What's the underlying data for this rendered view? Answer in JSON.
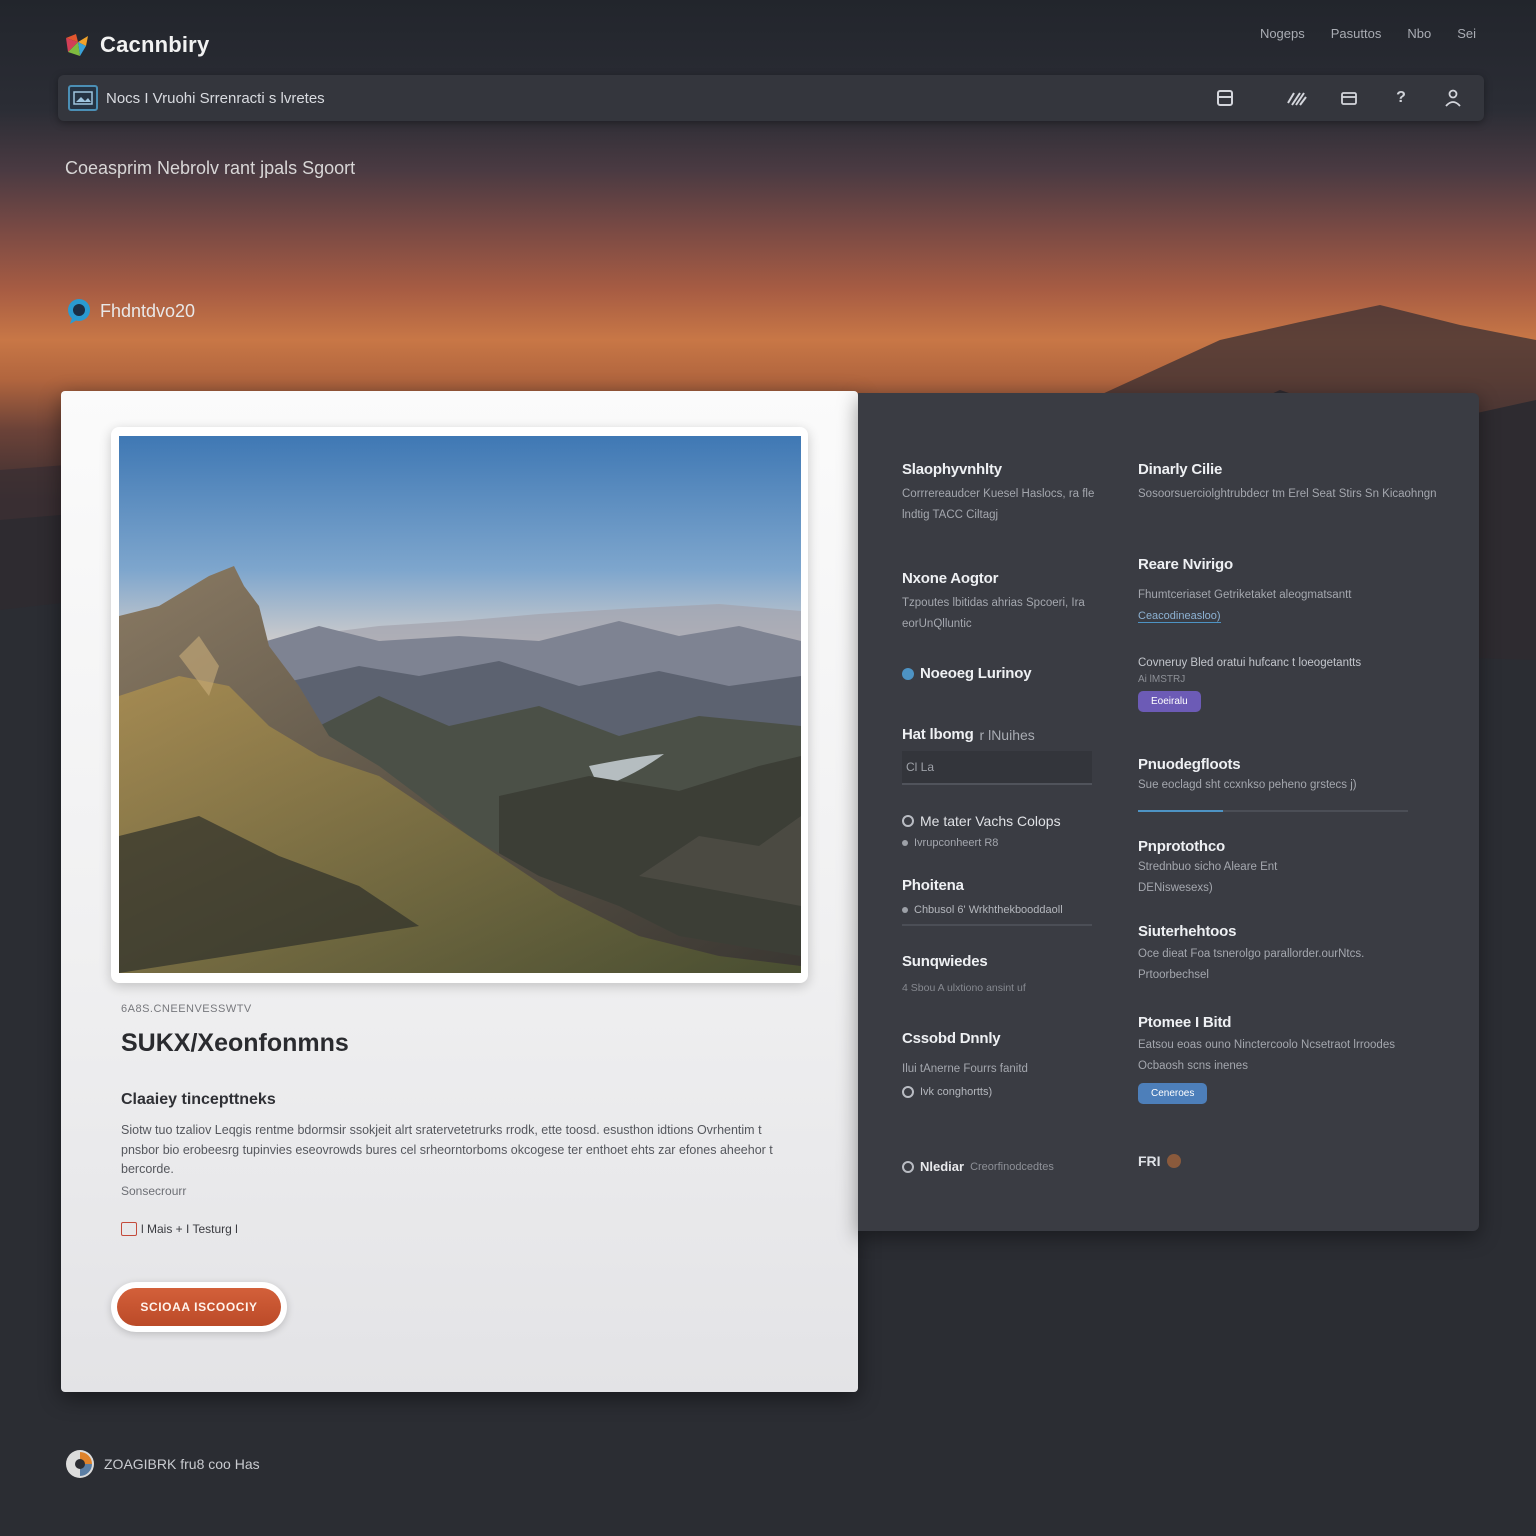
{
  "header": {
    "brand_name": "Cacnnbiry",
    "nav": [
      "Nogeps",
      "Pasuttos",
      "Nbo",
      "Sei"
    ]
  },
  "toolbar": {
    "path": "Nocs I Vruohi Srrenracti s lvretes",
    "icons": [
      "layout-icon",
      "signal-icon",
      "folder-icon",
      "help-icon",
      "user-icon"
    ]
  },
  "page": {
    "subtitle": "Coeasprim Nebrolv rant jpals Sgoort"
  },
  "user": {
    "name": "Fhdntdvo20"
  },
  "card": {
    "eyebrow": "6A8S.CNEENVESSWTV",
    "title": "SUKX/Xeonfonmns",
    "subhead": "Claaiey tincepttneks",
    "body": "Siotw tuo tzaliov Leqgis rentme bdormsir ssokjeit alrt sratervetetrurks rrodk, ette toosd. esusthon idtions Ovrhentim t pnsbor bio erobeesrg tupinvies eseovrowds bures cel srheorntorboms okcogese ter enthoet ehts zar efones aheehor t bercorde.",
    "note": "Sonsecrourr",
    "tags": "l Mais + I Testurg l",
    "cta_label": "SCIOAA ISCOOCIY"
  },
  "panel": {
    "col_a": {
      "b1": {
        "title": "Slaophyvnhlty",
        "text": "Corrrereaudcer Kuesel Haslocs, ra fle lndtig TACC Ciltagj"
      },
      "b2": {
        "title": "Nxone Aogtor",
        "text": "Tzpoutes lbitidas ahrias Spcoeri, Ira eorUnQlluntic"
      },
      "b3": {
        "title": "Noeoeg Lurinoy"
      },
      "b4": {
        "title": "Hat lbomg",
        "title_tail": "r lNuihes",
        "input_value": "Cl La"
      },
      "b5": {
        "title": "Me tater Vachs Colops",
        "sub": "Ivrupconheert R8"
      },
      "b6": {
        "title": "Phoitena",
        "sub": "Chbusol 6' Wrkhthekbooddaoll"
      },
      "b7": {
        "title": "Sunqwiedes",
        "sub": "4 Sbou A ulxtiono ansint  uf"
      },
      "b8": {
        "title": "Cssobd Dnnly",
        "text": "Ilui tAnerne Fourrs fanitd",
        "sub": "Ivk conghortts)"
      },
      "b9": {
        "title": "Nlediar",
        "tail": "Creorfinodcedtes"
      }
    },
    "col_b": {
      "b1": {
        "title": "Dinarly Cilie",
        "text": "Sosoorsuerciolghtrubdecr tm Erel Seat Stirs Sn Kicaohngn"
      },
      "b2": {
        "title": "Reare Nvirigo",
        "text": "Fhumtceriaset Getriketaket aleogmatsantt",
        "link": "Ceacodineasloo)"
      },
      "b3": {
        "text": "Covneruy Bled oratui hufcanc t loeogetantts",
        "sub": "Ai lMSTRJ",
        "button": "Eoeiralu"
      },
      "b4": {
        "title": "Pnuodegfloots",
        "text": "Sue eoclagd sht ccxnkso peheno grstecs j)"
      },
      "b5": {
        "title": "Pnprotothco",
        "text": "Strednbuo sicho Aleare Ent DENiswesexs)"
      },
      "b6": {
        "title": "Siuterhehtoos",
        "text": "Oce dieat Foa tsnerolgo parallorder.ourNtcs. Prtoorbechsel"
      },
      "b7": {
        "title": "Ptomee I Bitd",
        "text": "Eatsou eoas ouno Ninctercoolo Ncsetraot lrroodes Ocbaosh scns inenes",
        "button": "Ceneroes"
      },
      "b8": {
        "tag": "FRI"
      }
    }
  },
  "footer": {
    "text": "ZOAGIBRK fru8 coo Has"
  }
}
